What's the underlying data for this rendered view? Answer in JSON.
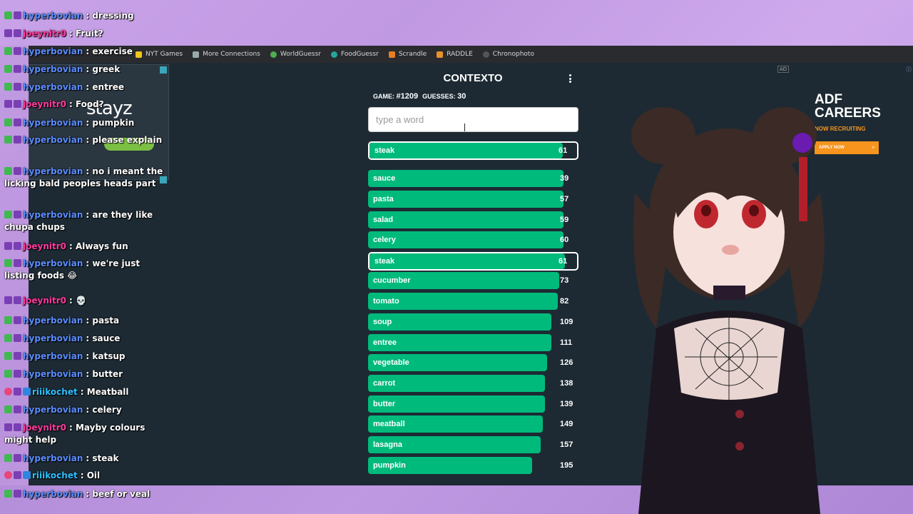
{
  "bookmarks": [
    "NYT Games",
    "More Connections",
    "WorldGuessr",
    "FoodGuessr",
    "Scrandle",
    "RADDLE",
    "Chronophoto"
  ],
  "ad_left": {
    "brand": "stayz"
  },
  "ad_right": {
    "tag": "AD",
    "brand_line1": "ADF",
    "brand_line2": "CAREERS",
    "recruiting": "NOW RECRUITING",
    "apply": "APPLY NOW"
  },
  "contexto": {
    "title": "CONTEXTO",
    "game_label": "GAME:",
    "game_number": "#1209",
    "guesses_label": "GUESSES:",
    "guesses_count": "30",
    "input_placeholder": "type a word",
    "last_guess": {
      "word": "steak",
      "distance": "61",
      "fill": 0.93
    },
    "guesses": [
      {
        "word": "sauce",
        "distance": "39",
        "fill": 0.93,
        "selected": false
      },
      {
        "word": "pasta",
        "distance": "57",
        "fill": 0.93,
        "selected": false
      },
      {
        "word": "salad",
        "distance": "59",
        "fill": 0.93,
        "selected": false
      },
      {
        "word": "celery",
        "distance": "60",
        "fill": 0.93,
        "selected": false
      },
      {
        "word": "steak",
        "distance": "61",
        "fill": 0.93,
        "selected": true
      },
      {
        "word": "cucumber",
        "distance": "73",
        "fill": 0.91,
        "selected": false
      },
      {
        "word": "tomato",
        "distance": "82",
        "fill": 0.9,
        "selected": false
      },
      {
        "word": "soup",
        "distance": "109",
        "fill": 0.87,
        "selected": false
      },
      {
        "word": "entree",
        "distance": "111",
        "fill": 0.87,
        "selected": false
      },
      {
        "word": "vegetable",
        "distance": "126",
        "fill": 0.85,
        "selected": false
      },
      {
        "word": "carrot",
        "distance": "138",
        "fill": 0.84,
        "selected": false
      },
      {
        "word": "butter",
        "distance": "139",
        "fill": 0.84,
        "selected": false
      },
      {
        "word": "meatball",
        "distance": "149",
        "fill": 0.83,
        "selected": false
      },
      {
        "word": "lasagna",
        "distance": "157",
        "fill": 0.82,
        "selected": false
      },
      {
        "word": "pumpkin",
        "distance": "195",
        "fill": 0.78,
        "selected": false
      }
    ]
  },
  "chat": [
    {
      "user": "hyperbovian",
      "text": "dressing",
      "color": "blue",
      "badges": [
        "check",
        "sub"
      ]
    },
    {
      "user": "joeynitr0",
      "text": "Fruit?",
      "color": "pink",
      "badges": [
        "sub",
        "sub"
      ]
    },
    {
      "user": "hyperbovian",
      "text": "exercise",
      "color": "blue",
      "badges": [
        "check",
        "sub"
      ]
    },
    {
      "user": "hyperbovian",
      "text": "greek",
      "color": "blue",
      "badges": [
        "check",
        "sub"
      ]
    },
    {
      "user": "hyperbovian",
      "text": "entree",
      "color": "blue",
      "badges": [
        "check",
        "sub"
      ]
    },
    {
      "user": "joeynitr0",
      "text": "Food?",
      "color": "pink",
      "badges": [
        "sub",
        "sub"
      ]
    },
    {
      "user": "hyperbovian",
      "text": "pumpkin",
      "color": "blue",
      "badges": [
        "check",
        "sub"
      ]
    },
    {
      "user": "hyperbovian",
      "text": "please explain",
      "color": "blue",
      "badges": [
        "check",
        "sub"
      ]
    },
    {
      "user": "hyperbovian",
      "text": "no i meant the licking bald peoples heads part",
      "color": "blue",
      "badges": [
        "check",
        "sub"
      ]
    },
    {
      "user": "hyperbovian",
      "text": "are they like chupa chups",
      "color": "blue",
      "badges": [
        "check",
        "sub"
      ]
    },
    {
      "user": "joeynitr0",
      "text": "Always fun",
      "color": "pink",
      "badges": [
        "sub",
        "sub"
      ]
    },
    {
      "user": "hyperbovian",
      "text": "we're just listing foods 😂",
      "color": "blue",
      "badges": [
        "check",
        "sub"
      ]
    },
    {
      "user": "joeynitr0",
      "text": "💀",
      "color": "pink",
      "badges": [
        "sub",
        "sub"
      ]
    },
    {
      "user": "hyperbovian",
      "text": "pasta",
      "color": "blue",
      "badges": [
        "check",
        "sub"
      ]
    },
    {
      "user": "hyperbovian",
      "text": "sauce",
      "color": "blue",
      "badges": [
        "check",
        "sub"
      ]
    },
    {
      "user": "hyperbovian",
      "text": "katsup",
      "color": "blue",
      "badges": [
        "check",
        "sub"
      ]
    },
    {
      "user": "hyperbovian",
      "text": "butter",
      "color": "blue",
      "badges": [
        "check",
        "sub"
      ]
    },
    {
      "user": "riiikochet",
      "text": "Meatball",
      "color": "cyan",
      "badges": [
        "heart",
        "star",
        "crown"
      ]
    },
    {
      "user": "hyperbovian",
      "text": "celery",
      "color": "blue",
      "badges": [
        "check",
        "sub"
      ]
    },
    {
      "user": "joeynitr0",
      "text": "Mayby colours might help",
      "color": "pink",
      "badges": [
        "sub",
        "sub"
      ]
    },
    {
      "user": "hyperbovian",
      "text": "steak",
      "color": "blue",
      "badges": [
        "check",
        "sub"
      ]
    },
    {
      "user": "riiikochet",
      "text": "Oil",
      "color": "cyan",
      "badges": [
        "heart",
        "star",
        "crown"
      ]
    },
    {
      "user": "hyperbovian",
      "text": "beef or veal",
      "color": "blue",
      "badges": [
        "check",
        "sub"
      ]
    }
  ]
}
